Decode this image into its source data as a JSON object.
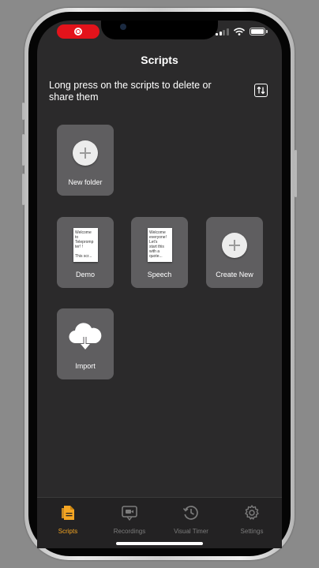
{
  "header": {
    "title": "Scripts"
  },
  "hint_text": "Long press on the scripts to delete or share them",
  "tiles": {
    "new_folder": {
      "label": "New folder"
    },
    "demo": {
      "label": "Demo",
      "preview": "Welcome\nto\nTelepromp\nter!    !\n\nThis scr..."
    },
    "speech": {
      "label": "Speech",
      "preview": "Welcome\neveryone!\nLet's\nstart this\nwith a\nquote..."
    },
    "create_new": {
      "label": "Create New"
    },
    "import": {
      "label": "Import"
    }
  },
  "tabbar": {
    "tabs": [
      {
        "label": "Scripts",
        "icon": "scripts-icon",
        "active": true
      },
      {
        "label": "Recordings",
        "icon": "recordings-icon",
        "active": false
      },
      {
        "label": "Visual Timer",
        "icon": "visual-timer-icon",
        "active": false
      },
      {
        "label": "Settings",
        "icon": "settings-icon",
        "active": false
      }
    ]
  },
  "colors": {
    "background": "#2b2a2b",
    "tile": "#5f5e60",
    "accent": "#f5a623",
    "recording": "#e3131b"
  }
}
